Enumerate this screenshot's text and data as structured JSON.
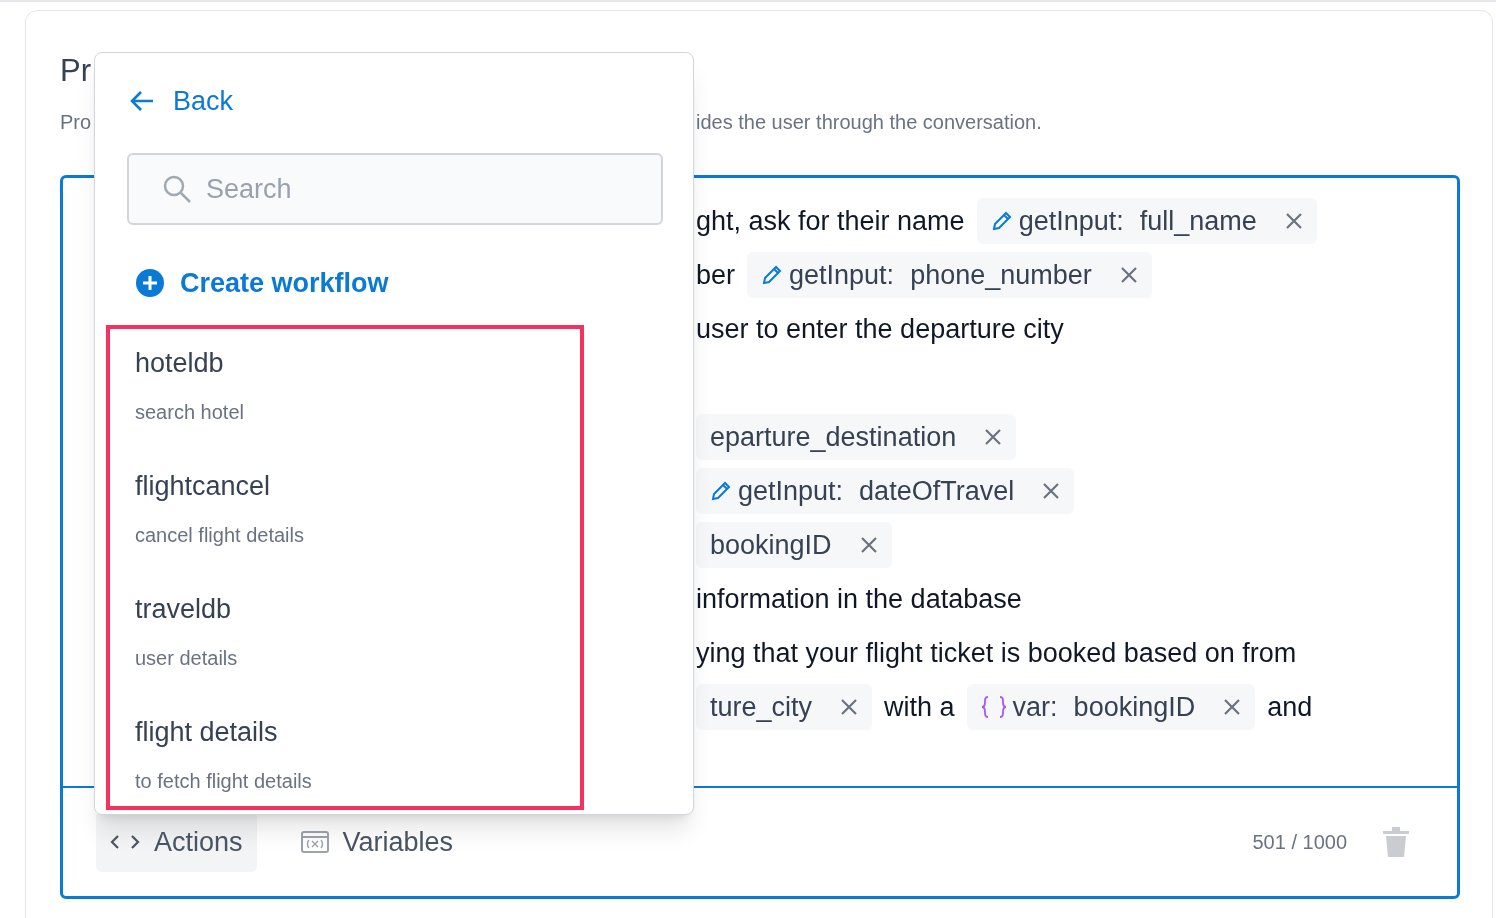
{
  "header": {
    "title": "Pr",
    "description_left": "Pro",
    "description_right": "ides the user through the conversation."
  },
  "editor": {
    "lines": [
      {
        "segments": [
          {
            "kind": "text",
            "text": "ght, ask for their name"
          },
          {
            "kind": "input",
            "label": "getInput:",
            "value": "full_name"
          }
        ]
      },
      {
        "segments": [
          {
            "kind": "text",
            "text": "ber"
          },
          {
            "kind": "input",
            "label": "getInput:",
            "value": "phone_number"
          }
        ]
      },
      {
        "segments": [
          {
            "kind": "text",
            "text": "user to enter the departure city"
          }
        ]
      },
      {
        "segments": [
          {
            "kind": "partial",
            "value": "eparture_destination"
          }
        ]
      },
      {
        "segments": [
          {
            "kind": "input",
            "label": "getInput:",
            "value": "dateOfTravel"
          }
        ]
      },
      {
        "segments": [
          {
            "kind": "partial",
            "value": "bookingID"
          }
        ]
      },
      {
        "segments": [
          {
            "kind": "text",
            "text": "information in the database"
          }
        ]
      },
      {
        "segments": [
          {
            "kind": "text",
            "text": "ying that your flight ticket is booked based on from"
          }
        ]
      },
      {
        "segments": [
          {
            "kind": "partial",
            "value": "ture_city"
          },
          {
            "kind": "text",
            "text": "with a"
          },
          {
            "kind": "var",
            "label": "var:",
            "value": "bookingID"
          },
          {
            "kind": "text",
            "text": "and"
          }
        ]
      }
    ]
  },
  "footer": {
    "buttons": [
      {
        "kind": "code",
        "label": "Actions",
        "selected": true
      },
      {
        "kind": "variables",
        "label": "Variables",
        "selected": false
      }
    ],
    "counter": "501 / 1000"
  },
  "popup": {
    "back": "Back",
    "search_placeholder": "Search",
    "create": "Create workflow",
    "workflows": [
      {
        "name": "hoteldb",
        "description": "search hotel"
      },
      {
        "name": "flightcancel",
        "description": "cancel flight details"
      },
      {
        "name": "traveldb",
        "description": "user details"
      },
      {
        "name": "flight details",
        "description": "to fetch flight details"
      }
    ]
  }
}
